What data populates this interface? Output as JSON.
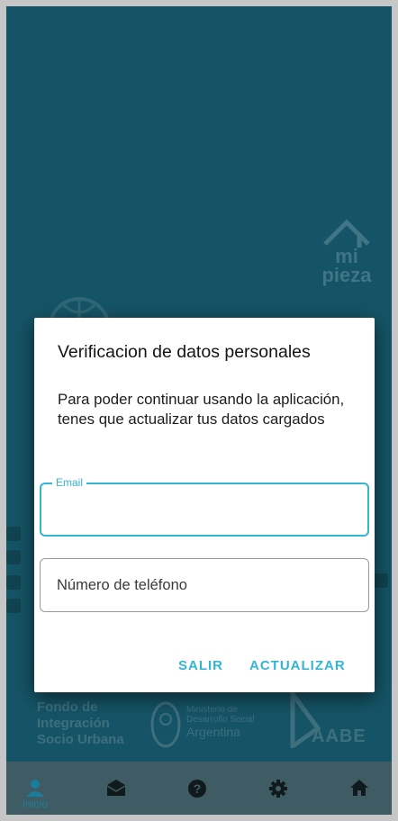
{
  "app": {
    "brand": "mi pieza",
    "accent": "#33b5d3"
  },
  "dialog": {
    "title": "Verificacion de datos personales",
    "message": "Para poder continuar usando la aplicación, tenes que actualizar tus datos cargados",
    "email": {
      "label": "Email",
      "value": ""
    },
    "phone": {
      "placeholder": "Número de teléfono",
      "value": ""
    },
    "cancel_label": "SALIR",
    "confirm_label": "ACTUALIZAR"
  },
  "footer_logos": {
    "fisu": "Fondo de Integración Socio Urbana",
    "ministerio_small": "Ministerio de Desarrollo Social",
    "ministerio_big": "Argentina",
    "aabe": "AABE"
  },
  "nav": {
    "items": [
      {
        "icon": "person-icon",
        "label": "Inicio",
        "active": true
      },
      {
        "icon": "mail-icon",
        "label": ""
      },
      {
        "icon": "help-icon",
        "label": ""
      },
      {
        "icon": "settings-icon",
        "label": ""
      },
      {
        "icon": "home-icon",
        "label": ""
      }
    ]
  }
}
